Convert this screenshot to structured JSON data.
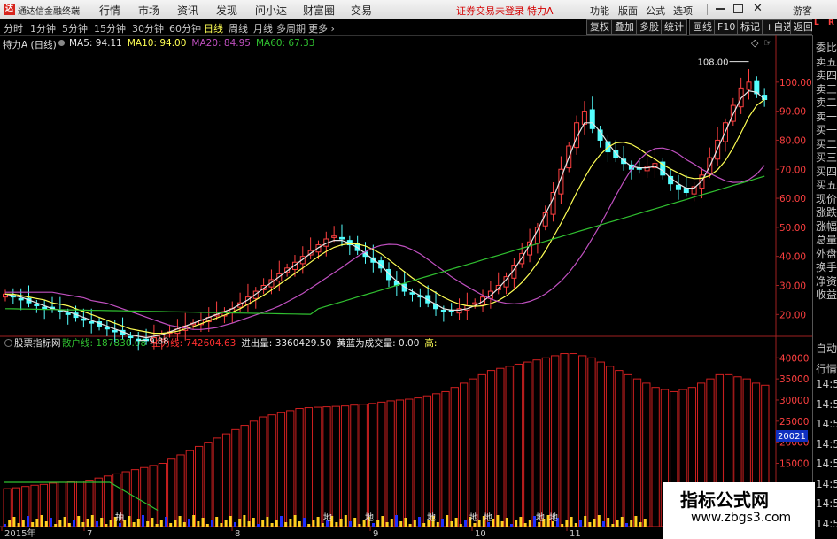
{
  "topbar": {
    "app_title": "通达信金融终端",
    "menus": [
      "行情",
      "市场",
      "资讯",
      "发现",
      "问小达",
      "财富圈",
      "交易"
    ],
    "status_text": "证券交易未登录",
    "stock_name": "特力A",
    "right_menus": [
      "功能",
      "版面",
      "公式",
      "选项"
    ],
    "guest": "游客",
    "logo_glyph": "达"
  },
  "periodbar": {
    "periods": [
      "分时",
      "1分钟",
      "5分钟",
      "15分钟",
      "30分钟",
      "60分钟",
      "日线",
      "周线",
      "月线",
      "多周期",
      "更多"
    ],
    "active_period": "日线",
    "tools": [
      "复权",
      "叠加",
      "多股",
      "统计",
      "画线",
      "F10",
      "标记",
      "+自选",
      "返回"
    ]
  },
  "main_indicators": {
    "title": "特力A (日线)",
    "items": [
      {
        "text": "MA5: 94.11",
        "color": "#e6e6e6"
      },
      {
        "text": "MA10: 94.00",
        "color": "#ffff54"
      },
      {
        "text": "MA20: 84.95",
        "color": "#c050c0"
      },
      {
        "text": "MA60: 67.33",
        "color": "#30c030"
      }
    ]
  },
  "sub_indicators": {
    "title": "股票指标网",
    "items": [
      {
        "text": "散户线: 187830.08",
        "color": "#30c030"
      },
      {
        "text": "主力线: 742604.63",
        "color": "#ff3030"
      },
      {
        "text": "进出量: 3360429.50",
        "color": "#e6e6e6"
      },
      {
        "text": "黄蓝为成交量: 0.00",
        "color": "#e6e6e6"
      },
      {
        "text": "高:",
        "color": "#ffff54"
      }
    ]
  },
  "right_panel": {
    "corner_top": "L",
    "corner_bottom": "R",
    "labels": [
      "委比",
      "卖五",
      "卖四",
      "卖三",
      "卖二",
      "卖一",
      "买一",
      "买二",
      "买三",
      "买四",
      "买五",
      "现价",
      "涨跌",
      "涨幅",
      "总量",
      "外盘",
      "换手",
      "净资",
      "收益",
      "自动",
      "行情",
      "14:50",
      "14:50",
      "14:50",
      "14:50",
      "14:50",
      "14:50",
      "14:50",
      "14:50"
    ]
  },
  "annotations": {
    "high": "108.00",
    "low": "9.88",
    "sub_readout": "20021",
    "sub_marks": [
      "抽",
      "地",
      "地",
      "地",
      "地",
      "地",
      "地",
      "地"
    ]
  },
  "watermark": {
    "line1": "指标公式网",
    "line2": "www.zbgs3.com"
  },
  "chart_data": [
    {
      "type": "candlestick",
      "title": "特力A (日线)",
      "y_axis_ticks": [
        "100.00",
        "90.00",
        "80.00",
        "70.00",
        "60.00",
        "50.00",
        "40.00",
        "30.00",
        "20.00"
      ],
      "x_axis_ticks": [
        "2015年",
        "7",
        "8",
        "9",
        "10",
        "11"
      ],
      "ylim": [
        14,
        110
      ],
      "high": 108.0,
      "low": 9.88,
      "close_series": [
        27,
        26,
        25,
        24,
        23,
        22,
        22,
        21,
        20,
        19,
        18,
        17,
        16,
        15,
        14,
        13,
        12,
        11,
        11,
        12,
        13,
        14,
        15,
        16,
        17,
        18,
        19,
        20,
        21,
        22,
        24,
        26,
        28,
        30,
        32,
        34,
        36,
        38,
        40,
        42,
        44,
        46,
        47,
        46,
        44,
        42,
        40,
        38,
        36,
        32,
        30,
        28,
        27,
        26,
        24,
        22,
        21,
        21,
        22,
        23,
        24,
        26,
        28,
        30,
        33,
        37,
        41,
        45,
        50,
        55,
        62,
        70,
        78,
        86,
        90,
        84,
        80,
        76,
        74,
        72,
        70,
        70,
        71,
        72,
        68,
        65,
        63,
        62,
        64,
        68,
        74,
        80,
        86,
        92,
        98,
        100,
        96,
        94
      ],
      "ma5": [
        27,
        26.5,
        26,
        25,
        24,
        23,
        22,
        21.5,
        21,
        20,
        19,
        18,
        17,
        16,
        15,
        14,
        13,
        12.5,
        12,
        12.5,
        13,
        14,
        15,
        16,
        17,
        18,
        19,
        20,
        21,
        22,
        23.5,
        25,
        27,
        29,
        31,
        33,
        35,
        37,
        39,
        41,
        43,
        44.5,
        45.5,
        45.5,
        44.5,
        43,
        41,
        39,
        37,
        34,
        31.5,
        29.5,
        28,
        26.5,
        25,
        23.5,
        22,
        21.5,
        21.5,
        22,
        23,
        24.5,
        26.5,
        29,
        32,
        35.5,
        39.5,
        44,
        49,
        54.5,
        60,
        67,
        74,
        81,
        86,
        86,
        83,
        79,
        75.5,
        73,
        71,
        70.5,
        70.5,
        71,
        69.5,
        67,
        65,
        63.5,
        63.5,
        66,
        71,
        77,
        83,
        89,
        94.5,
        97,
        96.5,
        94.1
      ],
      "ma10": [
        27,
        27,
        26.5,
        26,
        25.5,
        25,
        24,
        23.5,
        23,
        22,
        21,
        20,
        19,
        18,
        17,
        16,
        15,
        14.5,
        14,
        13.5,
        13.5,
        13.8,
        14.2,
        15,
        15.8,
        16.8,
        17.8,
        18.8,
        19.8,
        20.8,
        22,
        23.5,
        25,
        26.6,
        28.4,
        30.3,
        32.2,
        34.1,
        36,
        38,
        40,
        41.7,
        43.1,
        44,
        44.4,
        44.3,
        43.6,
        42.4,
        40.9,
        38.9,
        36.8,
        34.7,
        32.6,
        30.8,
        29.1,
        27.5,
        25.9,
        24.6,
        23.6,
        23,
        22.8,
        23,
        23.7,
        24.8,
        26.4,
        28.5,
        31,
        34.1,
        37.8,
        41.9,
        46.6,
        51.4,
        56.6,
        62,
        67,
        71.6,
        75,
        77.6,
        79.1,
        79.3,
        78.6,
        77.1,
        75.1,
        73.5,
        71.6,
        70.1,
        68.7,
        67.4,
        66.8,
        66.9,
        67.8,
        69.8,
        73,
        77.4,
        82.6,
        88,
        92,
        94
      ]
    },
    {
      "type": "bar",
      "title": "股票指标网",
      "y_axis_ticks": [
        "40000",
        "35000",
        "30000",
        "25000",
        "20000",
        "15000"
      ],
      "ylim": [
        0,
        43000
      ],
      "values": [
        9000,
        9200,
        9500,
        9800,
        10000,
        10300,
        10500,
        10600,
        10800,
        11000,
        11500,
        12000,
        12500,
        13000,
        13500,
        14000,
        14500,
        15000,
        16000,
        17000,
        18000,
        19000,
        20000,
        21000,
        22000,
        23000,
        24000,
        25000,
        26000,
        26500,
        27000,
        27500,
        28000,
        28200,
        28300,
        28400,
        28500,
        28600,
        28800,
        29000,
        29200,
        29500,
        29800,
        30000,
        30200,
        30500,
        31000,
        31500,
        32000,
        33000,
        34000,
        35000,
        36000,
        37000,
        37500,
        38000,
        38500,
        39000,
        39500,
        40000,
        40500,
        41000,
        41000,
        40500,
        40000,
        39000,
        38000,
        37000,
        36000,
        35000,
        34000,
        33000,
        32500,
        32000,
        32500,
        33000,
        34000,
        35000,
        36000,
        36000,
        35500,
        35000,
        34000,
        33500
      ]
    }
  ]
}
